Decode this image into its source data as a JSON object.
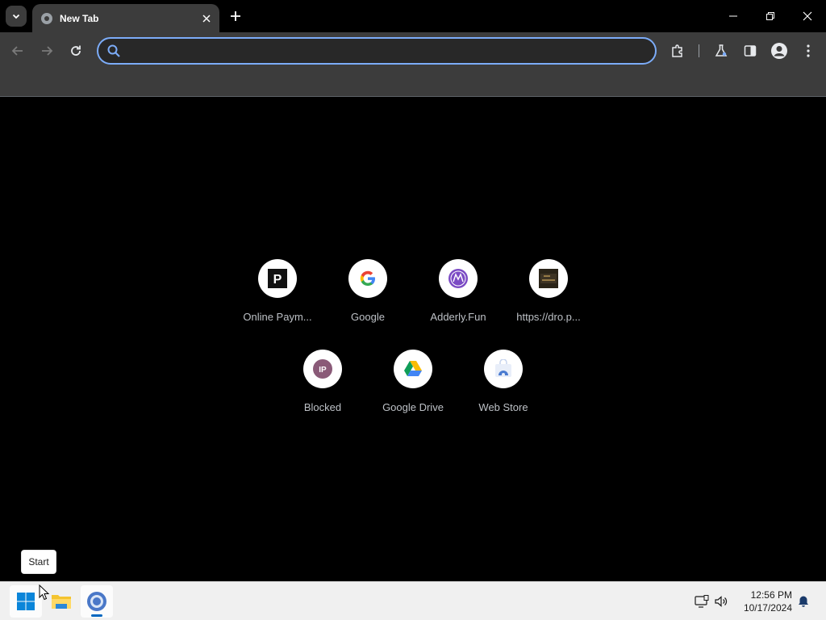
{
  "browser": {
    "tab": {
      "title": "New Tab"
    },
    "omnibox": {
      "value": "",
      "placeholder": ""
    }
  },
  "shortcuts": [
    {
      "label": "Online Paym...",
      "icon": "p-logo-icon"
    },
    {
      "label": "Google",
      "icon": "google-g-icon"
    },
    {
      "label": "Adderly.Fun",
      "icon": "adderly-logo-icon"
    },
    {
      "label": "https://dro.p...",
      "icon": "site-thumbnail-icon"
    },
    {
      "label": "Blocked",
      "icon": "ip-logo-icon",
      "badge": "IP"
    },
    {
      "label": "Google Drive",
      "icon": "google-drive-icon"
    },
    {
      "label": "Web Store",
      "icon": "web-store-icon"
    }
  ],
  "tooltip": {
    "text": "Start"
  },
  "taskbar": {
    "clock": {
      "time": "12:56 PM",
      "date": "10/17/2024"
    }
  },
  "colors": {
    "accent": "#7cacf8",
    "toolbar": "#3c3c3c",
    "taskbar": "#f0f0f0"
  }
}
